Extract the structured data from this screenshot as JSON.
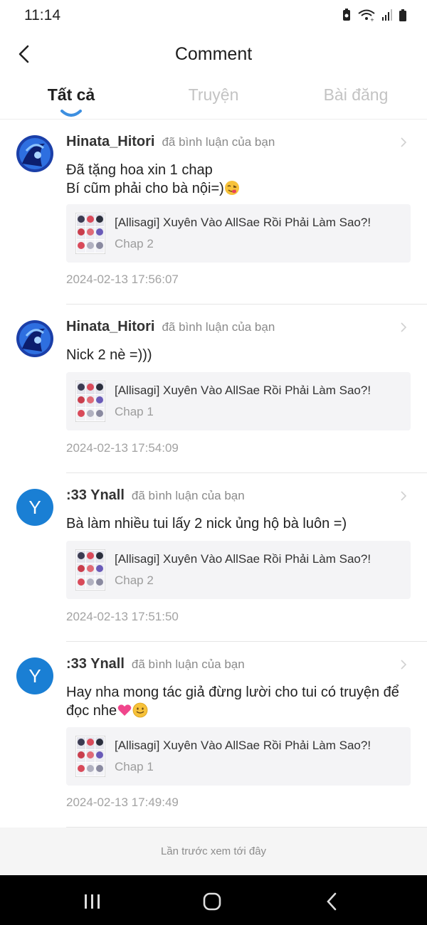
{
  "status_bar": {
    "time": "11:14"
  },
  "header": {
    "title": "Comment"
  },
  "tabs": [
    {
      "label": "Tất cả",
      "active": true
    },
    {
      "label": "Truyện",
      "active": false
    },
    {
      "label": "Bài đăng",
      "active": false
    }
  ],
  "comments": [
    {
      "username": "Hinata_Hitori",
      "action": "đã bình luận của bạn",
      "avatar": "photo",
      "text_line1": "Đã tặng hoa xin 1 chap",
      "text_line2": "Bí cũm phải cho bà nội=)",
      "text_emoji": "face-savoring-food-emoji",
      "series_title": "[Allisagi] Xuyên Vào AllSae Rồi Phải Làm Sao?!",
      "chapter": "Chap 2",
      "timestamp": "2024-02-13 17:56:07"
    },
    {
      "username": "Hinata_Hitori",
      "action": "đã bình luận của bạn",
      "avatar": "photo",
      "text_line1": "Nick 2 nè =)))",
      "series_title": "[Allisagi] Xuyên Vào AllSae Rồi Phải Làm Sao?!",
      "chapter": "Chap 1",
      "timestamp": "2024-02-13 17:54:09"
    },
    {
      "username": ":33 Ynall",
      "action": "đã bình luận của bạn",
      "avatar_letter": "Y",
      "text_line1": "Bà làm nhiều tui lấy 2 nick ủng hộ bà luôn =)",
      "series_title": "[Allisagi] Xuyên Vào AllSae Rồi Phải Làm Sao?!",
      "chapter": "Chap 2",
      "timestamp": "2024-02-13 17:51:50"
    },
    {
      "username": ":33 Ynall",
      "action": "đã bình luận của bạn",
      "avatar_letter": "Y",
      "text_line1": "Hay nha mong tác giả đừng lười cho tui có truyện để",
      "text_line2": "đọc nhe",
      "text_emoji": "pink-heart-and-smile-emoji",
      "series_title": "[Allisagi] Xuyên Vào AllSae Rồi Phải Làm Sao?!",
      "chapter": "Chap 1",
      "timestamp": "2024-02-13 17:49:49"
    }
  ],
  "footer_note": "Lần trước xem tới đây",
  "colors": {
    "accent": "#1a7fd4",
    "tab_indicator": "#3d8fe0"
  },
  "icons": [
    "back-arrow-icon",
    "chevron-right-icon",
    "recents-icon",
    "home-icon",
    "back-nav-icon",
    "battery-icon",
    "wifi-icon",
    "signal-icon"
  ]
}
